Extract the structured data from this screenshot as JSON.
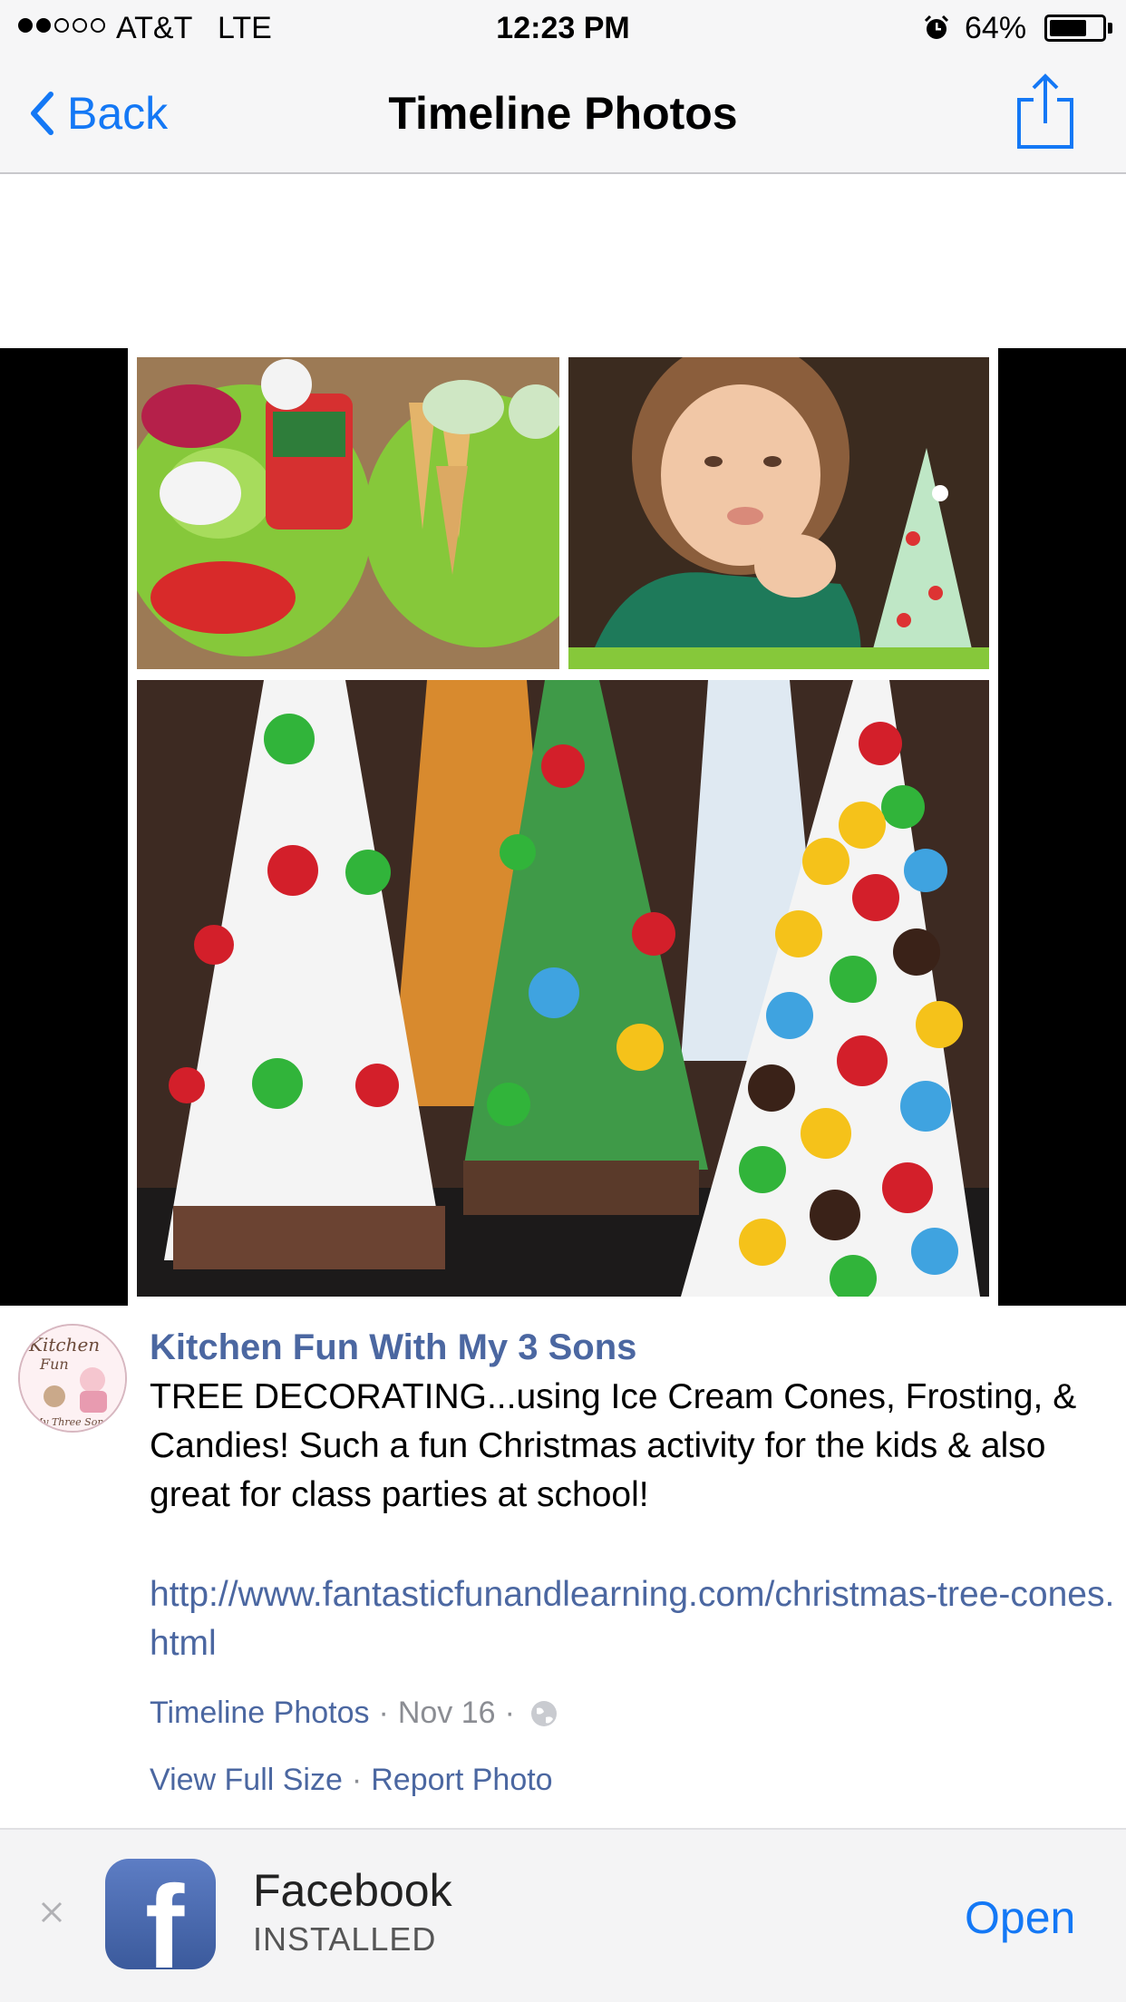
{
  "status_bar": {
    "carrier": "AT&T",
    "network": "LTE",
    "time": "12:23 PM",
    "battery_percent": "64%",
    "battery_level": 0.64,
    "signal_bars_filled": 2,
    "signal_bars_total": 5
  },
  "nav": {
    "back_label": "Back",
    "title": "Timeline Photos"
  },
  "post": {
    "author": "Kitchen Fun With My 3 Sons",
    "caption": "TREE DECORATING...using Ice Cream Cones, Frosting, & Candies! Such a fun Christmas activity for the kids & also great for class parties at school!",
    "link": "http://www.fantasticfunandlearning.com/christmas-tree-cones.html",
    "album": "Timeline Photos",
    "date": "Nov 16",
    "separator": "·",
    "actions": {
      "view_full_size": "View Full Size",
      "report_photo": "Report Photo"
    },
    "avatar_logo_text": [
      "Kitchen",
      "Fun",
      "My Three Sons"
    ]
  },
  "app_banner": {
    "app_name": "Facebook",
    "status": "INSTALLED",
    "open_label": "Open"
  },
  "colors": {
    "ios_blue": "#1478f5",
    "facebook_link": "#4b67a1",
    "meta_gray": "#8b8d93"
  }
}
